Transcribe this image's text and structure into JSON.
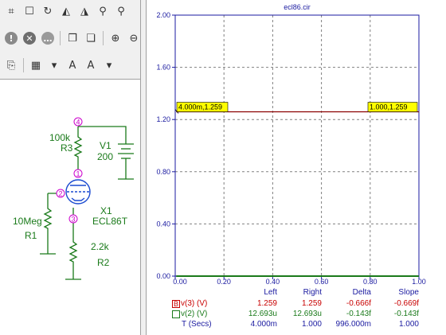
{
  "toolbar": {
    "rows": [
      [
        {
          "name": "select-icon",
          "glyph": "⌗"
        },
        {
          "name": "region-select-icon",
          "glyph": "☐"
        },
        {
          "name": "rotate-icon",
          "glyph": "↻"
        },
        {
          "name": "flip-horizontal-icon",
          "glyph": "◭"
        },
        {
          "name": "flip-vertical-icon",
          "glyph": "◮"
        },
        {
          "name": "find-icon",
          "glyph": "⚲"
        },
        {
          "name": "find-next-icon",
          "glyph": "⚲"
        }
      ],
      [
        {
          "name": "probe-icon",
          "glyph": "!",
          "color": "#8a8a8a",
          "round": true
        },
        {
          "name": "stop-icon",
          "glyph": "✕",
          "color": "#6e6e6e",
          "round": true
        },
        {
          "name": "more-icon",
          "glyph": "…",
          "color": "#9a9a9a",
          "round": true
        },
        {
          "name": "sep",
          "sep": true
        },
        {
          "name": "copy-icon",
          "glyph": "❐"
        },
        {
          "name": "paste-icon",
          "glyph": "❏"
        },
        {
          "name": "sep",
          "sep": true
        },
        {
          "name": "zoom-in-icon",
          "glyph": "⊕"
        },
        {
          "name": "zoom-out-icon",
          "glyph": "⊖"
        }
      ],
      [
        {
          "name": "clipboard-icon",
          "glyph": "⎘"
        },
        {
          "name": "sep",
          "sep": true
        },
        {
          "name": "grid-icon",
          "glyph": "▦"
        },
        {
          "name": "dropdown-arrow-icon",
          "glyph": "▾"
        },
        {
          "name": "text-icon",
          "glyph": "A"
        },
        {
          "name": "text-style-icon",
          "glyph": "A"
        },
        {
          "name": "dropdown-arrow-icon",
          "glyph": "▾"
        }
      ]
    ]
  },
  "schematic": {
    "components": {
      "r3_value": "100k",
      "r3_name": "R3",
      "v1_name": "V1",
      "v1_value": "200",
      "r1_value": "10Meg",
      "r1_name": "R1",
      "x1_name": "X1",
      "x1_model": "ECL86T",
      "r2_value": "2.2k",
      "r2_name": "R2"
    },
    "nodes": {
      "n4": "4",
      "n1": "1",
      "n2": "2",
      "n3": "3"
    },
    "colors": {
      "wire": "#1a7a1a",
      "component": "#1a7a1a",
      "label": "#1a7a1a",
      "node": "#cc00cc",
      "tube": "#1a4ad0"
    }
  },
  "plot": {
    "title": "ecl86.cir",
    "cursor_left_label": "4.000m,1.259",
    "cursor_right_label": "1.000,1.259",
    "colors": {
      "axis": "#1a1aa0",
      "trace": "#8b0000",
      "grid": "#808080",
      "label_bg": "#ffff00"
    }
  },
  "chart_data": {
    "type": "line",
    "title": "ecl86.cir",
    "xlabel": "",
    "ylabel": "",
    "xlim": [
      0,
      1.0
    ],
    "ylim": [
      0,
      2.0
    ],
    "x_ticks": [
      "0.00",
      "0.20",
      "0.40",
      "0.60",
      "0.80",
      "1.00"
    ],
    "y_ticks": [
      "0.00",
      "0.40",
      "0.80",
      "1.20",
      "1.60",
      "2.00"
    ],
    "grid": true,
    "series": [
      {
        "name": "v(3) (V)",
        "x": [
          0.004,
          1.0
        ],
        "y": [
          1.259,
          1.259
        ],
        "color": "#8b0000"
      },
      {
        "name": "v(2) (V)",
        "x": [
          0.004,
          1.0
        ],
        "y": [
          1.2693e-05,
          1.2693e-05
        ],
        "color": "#1a7a1a"
      }
    ]
  },
  "readout": {
    "headers": {
      "left": "Left",
      "right": "Right",
      "delta": "Delta",
      "slope": "Slope"
    },
    "rows": [
      {
        "box": "B",
        "name": "v(3) (V)",
        "left": "1.259",
        "right": "1.259",
        "delta": "-0.666f",
        "slope": "-0.669f",
        "color": "#c80000",
        "box_color": "#c80000"
      },
      {
        "box": "",
        "name": "v(2) (V)",
        "left": "12.693u",
        "right": "12.693u",
        "delta": "-0.143f",
        "slope": "-0.143f",
        "color": "#1a7a1a",
        "box_color": "#1a7a1a"
      },
      {
        "box": null,
        "name": "T (Secs)",
        "left": "4.000m",
        "right": "1.000",
        "delta": "996.000m",
        "slope": "1.000",
        "color": "#1a1aa0"
      }
    ]
  }
}
